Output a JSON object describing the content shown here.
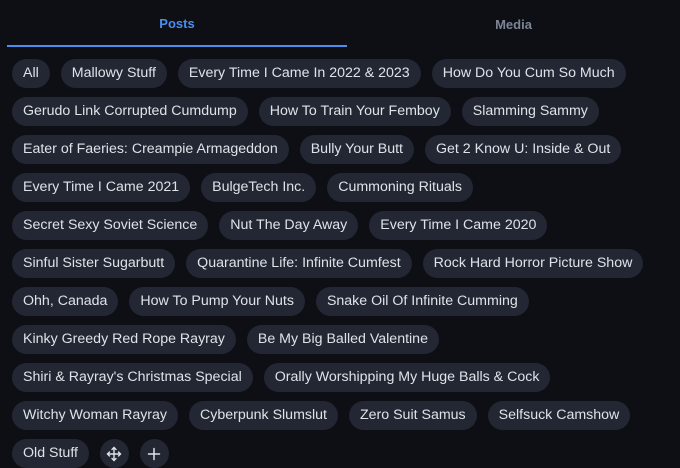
{
  "tabs": [
    {
      "label": "Posts",
      "active": true
    },
    {
      "label": "Media",
      "active": false
    }
  ],
  "chips": [
    "All",
    "Mallowy Stuff",
    "Every Time I Came In 2022 & 2023",
    "How Do You Cum So Much",
    "Gerudo Link Corrupted Cumdump",
    "How To Train Your Femboy",
    "Slamming Sammy",
    "Eater of Faeries: Creampie Armageddon",
    "Bully Your Butt",
    "Get 2 Know U: Inside & Out",
    "Every Time I Came 2021",
    "BulgeTech Inc.",
    "Cummoning Rituals",
    "Secret Sexy Soviet Science",
    "Nut The Day Away",
    "Every Time I Came 2020",
    "Sinful Sister Sugarbutt",
    "Quarantine Life: Infinite Cumfest",
    "Rock Hard Horror Picture Show",
    "Ohh, Canada",
    "How To Pump Your Nuts",
    "Snake Oil Of Infinite Cumming",
    "Kinky Greedy Red Rope Rayray",
    "Be My Big Balled Valentine",
    "Shiri & Rayray's Christmas Special",
    "Orally Worshipping My Huge Balls & Cock",
    "Witchy Woman Rayray",
    "Cyberpunk Slumslut",
    "Zero Suit Samus",
    "Selfsuck Camshow",
    "Old Stuff"
  ],
  "icons": {
    "reorder": "move-icon",
    "add": "plus-icon"
  },
  "colors": {
    "accent": "#4a8ef0",
    "background": "#0d0f14",
    "chip_bg": "#222733",
    "chip_text": "#dfe2e8",
    "tab_inactive": "#7d8496"
  }
}
